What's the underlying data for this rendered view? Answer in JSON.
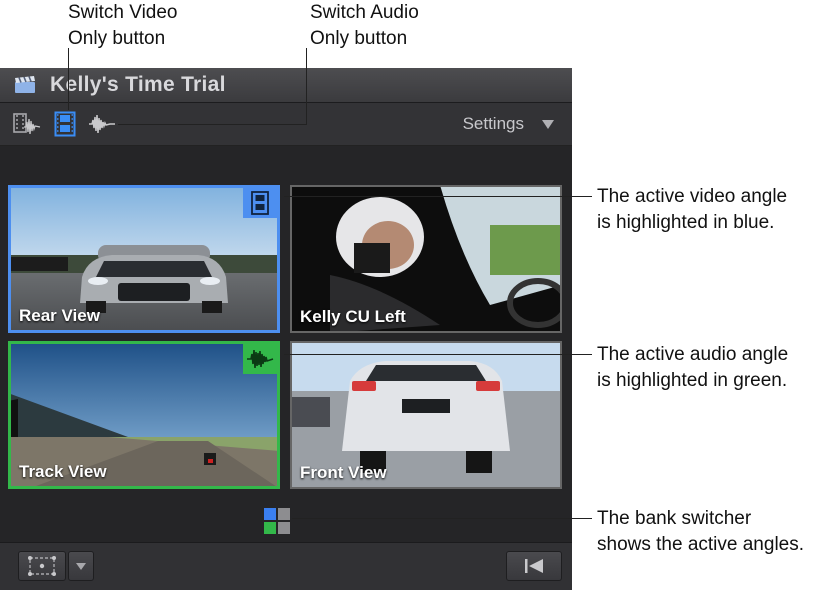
{
  "callouts": {
    "switch_video": [
      "Switch Video",
      "Only button"
    ],
    "switch_audio": [
      "Switch Audio",
      "Only button"
    ],
    "active_video": [
      "The active video angle",
      "is highlighted in blue."
    ],
    "active_audio": [
      "The active audio angle",
      "is highlighted in green."
    ],
    "bank_switcher": [
      "The bank switcher",
      "shows the active angles."
    ]
  },
  "viewer": {
    "title": "Kelly's Time Trial",
    "title_icon": "clapper-icon",
    "toolbar": {
      "buttons": [
        {
          "name": "switch-video-audio-button",
          "icon": "film-waveform-icon",
          "active": false
        },
        {
          "name": "switch-video-only-button",
          "icon": "film-icon",
          "active": true
        },
        {
          "name": "switch-audio-only-button",
          "icon": "waveform-icon",
          "active": false
        }
      ],
      "settings_label": "Settings"
    },
    "angles": [
      {
        "label": "Rear View",
        "state": "active-video",
        "color": "#4d8ff0"
      },
      {
        "label": "Kelly CU Left",
        "state": "inactive"
      },
      {
        "label": "Track View",
        "state": "active-audio",
        "color": "#33b84a"
      },
      {
        "label": "Front View",
        "state": "inactive"
      }
    ],
    "bank_switcher_icon": "bank-switcher-icon",
    "bottom_bar": {
      "left_icon": "clip-settings-icon",
      "left_menu_icon": "chevron-down-icon",
      "right_icon": "skip-back-icon"
    }
  }
}
